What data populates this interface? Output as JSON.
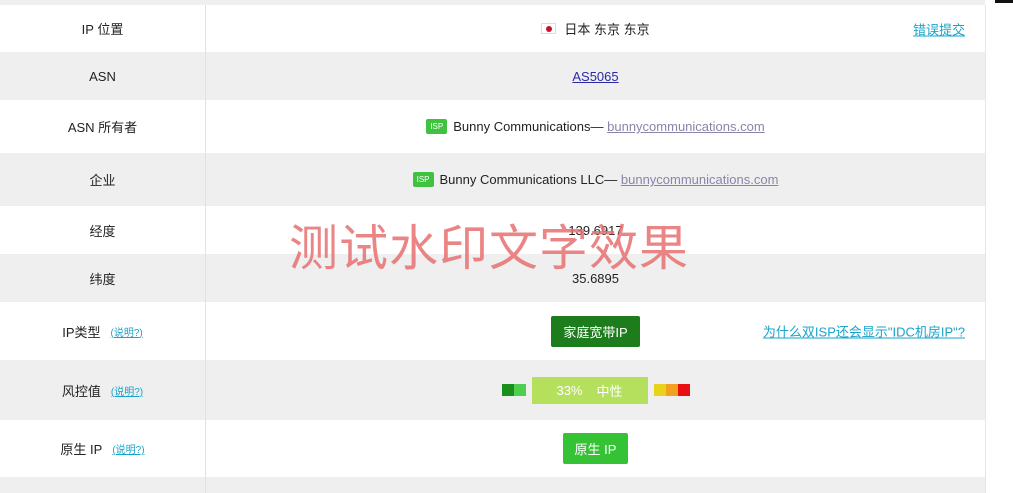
{
  "rows": {
    "ip_location": {
      "label": "IP 位置",
      "value": "日本 东京 东京",
      "flag_icon": "japan-flag-icon",
      "report_link": "错误提交"
    },
    "asn": {
      "label": "ASN",
      "value": "AS5065"
    },
    "asn_owner": {
      "label": "ASN 所有者",
      "badge": "ISP",
      "name": "Bunny Communications—",
      "domain": "bunnycommunications.com"
    },
    "enterprise": {
      "label": "企业",
      "badge": "ISP",
      "name": "Bunny Communications LLC—",
      "domain": "bunnycommunications.com"
    },
    "longitude": {
      "label": "经度",
      "value": "139.6917"
    },
    "latitude": {
      "label": "纬度",
      "value": "35.6895"
    },
    "ip_type": {
      "label": "IP类型",
      "help": "(说明?)",
      "badge": "家庭宽带IP",
      "question_link": "为什么双ISP还会显示\"IDC机房IP\"?"
    },
    "risk": {
      "label": "风控值",
      "help": "(说明?)",
      "percent": "33%",
      "level": "中性",
      "score_fraction": 0.33
    },
    "native_ip": {
      "label": "原生 IP",
      "help": "(说明?)",
      "badge": "原生 IP"
    }
  },
  "watermark": "测试水印文字效果",
  "colors": {
    "link": "#1aa3c9",
    "asn_link": "#2a2aa8",
    "isp_badge": "#3fc23f",
    "type_badge": "#1d7d1d",
    "native_badge": "#35c335",
    "risk_bar": "#b4e05e",
    "risk_low_dark": "#1b8f1b",
    "risk_low_light": "#4fcf4f",
    "risk_high_yellow": "#e8d21a",
    "risk_high_orange": "#f2a01f",
    "risk_high_red": "#e81010",
    "watermark": "#e86e6e"
  }
}
